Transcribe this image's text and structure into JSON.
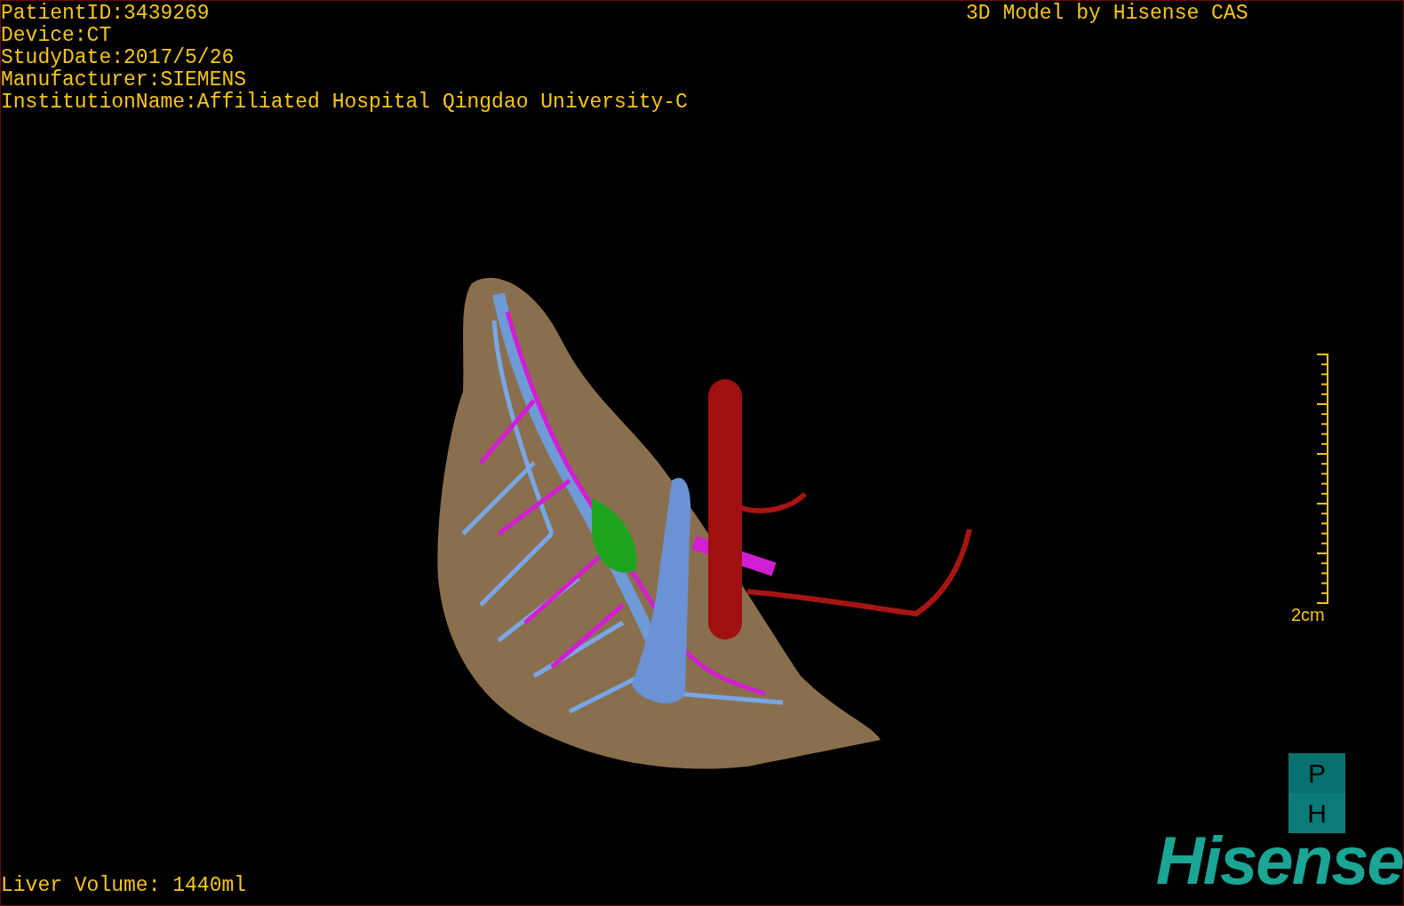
{
  "patient_info": [
    "PatientID:3439269",
    "Device:CT",
    "StudyDate:2017/5/26",
    "Manufacturer:SIEMENS",
    "InstitutionName:Affiliated Hospital Qingdao University-C"
  ],
  "model_credit": "3D Model by Hisense CAS",
  "scale_bar": {
    "label": "2cm"
  },
  "orientation_badge": [
    "P",
    "H"
  ],
  "logo": "Hisense",
  "volume": "Liver Volume: 1440ml"
}
